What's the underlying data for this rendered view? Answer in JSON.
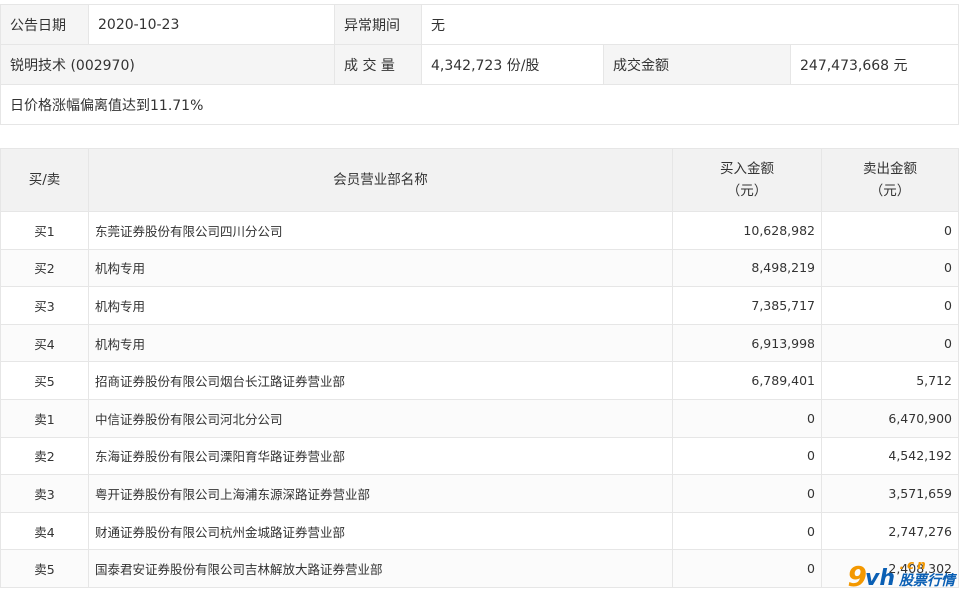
{
  "summary": {
    "date_label": "公告日期",
    "date_value": "2020-10-23",
    "period_label": "异常期间",
    "period_value": "无",
    "stock": "锐明技术 (002970)",
    "volume_label": "成 交 量",
    "volume_value": "4,342,723 份/股",
    "amount_label": "成交金额",
    "amount_value": "247,473,668 元",
    "description": "日价格涨幅偏离值达到11.71%"
  },
  "detail": {
    "headers": {
      "side": "买/卖",
      "name": "会员营业部名称",
      "buy_line1": "买入金额",
      "buy_line2": "（元）",
      "sell_line1": "卖出金额",
      "sell_line2": "（元）"
    },
    "rows": [
      {
        "side": "买1",
        "name": "东莞证券股份有限公司四川分公司",
        "buy": "10,628,982",
        "sell": "0"
      },
      {
        "side": "买2",
        "name": "机构专用",
        "buy": "8,498,219",
        "sell": "0"
      },
      {
        "side": "买3",
        "name": "机构专用",
        "buy": "7,385,717",
        "sell": "0"
      },
      {
        "side": "买4",
        "name": "机构专用",
        "buy": "6,913,998",
        "sell": "0"
      },
      {
        "side": "买5",
        "name": "招商证券股份有限公司烟台长江路证券营业部",
        "buy": "6,789,401",
        "sell": "5,712"
      },
      {
        "side": "卖1",
        "name": "中信证券股份有限公司河北分公司",
        "buy": "0",
        "sell": "6,470,900"
      },
      {
        "side": "卖2",
        "name": "东海证券股份有限公司溧阳育华路证券营业部",
        "buy": "0",
        "sell": "4,542,192"
      },
      {
        "side": "卖3",
        "name": "粤开证券股份有限公司上海浦东源深路证券营业部",
        "buy": "0",
        "sell": "3,571,659"
      },
      {
        "side": "卖4",
        "name": "财通证券股份有限公司杭州金城路证券营业部",
        "buy": "0",
        "sell": "2,747,276"
      },
      {
        "side": "卖5",
        "name": "国泰君安证券股份有限公司吉林解放大路证券营业部",
        "buy": "0",
        "sell": "2,408,302"
      }
    ]
  },
  "watermark": {
    "nine": "9",
    "vh": "vh",
    "cn": ".cn",
    "text": "股票行情"
  }
}
